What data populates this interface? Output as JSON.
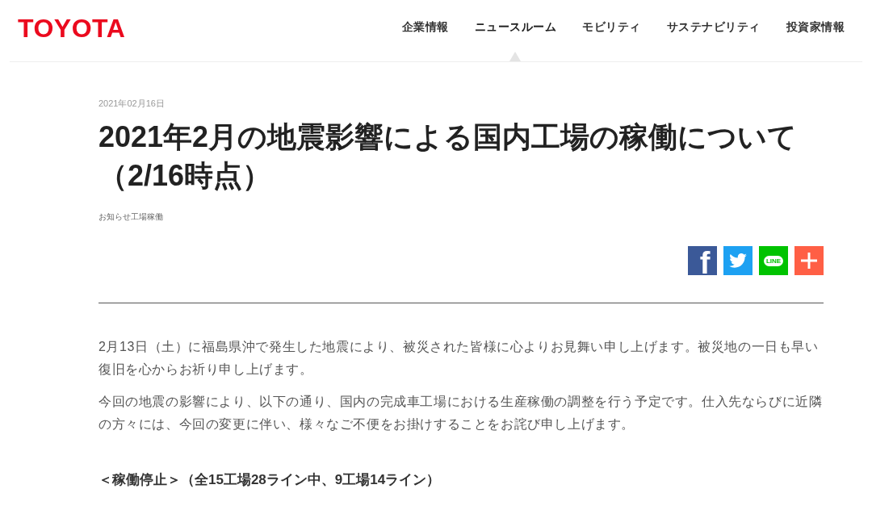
{
  "header": {
    "logo": "TOYOTA",
    "nav": [
      {
        "label": "企業情報",
        "selected": false
      },
      {
        "label": "ニュースルーム",
        "selected": true
      },
      {
        "label": "モビリティ",
        "selected": false
      },
      {
        "label": "サステナビリティ",
        "selected": false
      },
      {
        "label": "投資家情報",
        "selected": false
      }
    ]
  },
  "article": {
    "date": "2021年02月16日",
    "title": "2021年2月の地震影響による国内工場の稼働について（2/16時点）",
    "tag": "お知らせ工場稼働",
    "share_buttons": [
      {
        "kind": "facebook",
        "label": "f"
      },
      {
        "kind": "twitter"
      },
      {
        "kind": "line",
        "label": "LINE"
      },
      {
        "kind": "more"
      }
    ],
    "paragraphs": [
      "2月13日（土）に福島県沖で発生した地震により、被災された皆様に心よりお見舞い申し上げます。被災地の一日も早い復旧を心からお祈り申し上げます。",
      "今回の地震の影響により、以下の通り、国内の完成車工場における生産稼働の調整を行う予定です。仕入先ならびに近隣の方々には、今回の変更に伴い、様々なご不便をお掛けすることをお詫び申し上げます。"
    ],
    "section_heading": "＜稼働停止＞（全15工場28ライン中、9工場14ライン）"
  }
}
